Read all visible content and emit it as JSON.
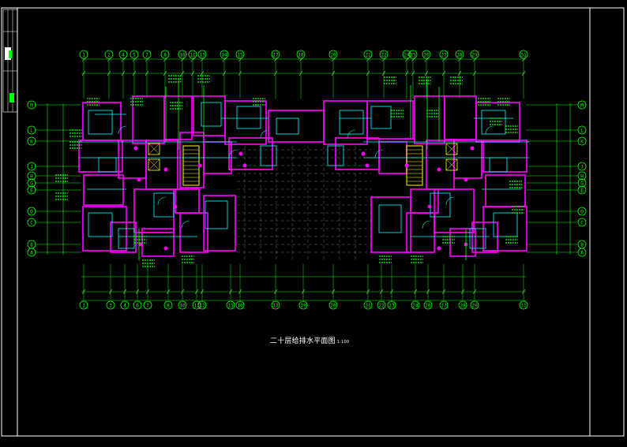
{
  "drawing": {
    "title": "二十层给排水平面图",
    "scale": "1:100",
    "colors": {
      "background": "#000000",
      "frame": "#ffffff",
      "axis": "#00ff00",
      "wall": "#ff00ff",
      "detail": "#00ffff",
      "fixture": "#ffff00",
      "dim": "#ffffff"
    },
    "top_axis_labels": [
      "1",
      "2",
      "4",
      "5",
      "7",
      "8",
      "10",
      "11",
      "13",
      "14",
      "15",
      "17",
      "18",
      "20",
      "21",
      "22",
      "24",
      "25",
      "26",
      "27",
      "28",
      "29",
      "31"
    ],
    "bottom_axis_labels": [
      "1",
      "3",
      "4",
      "6",
      "7",
      "8",
      "10",
      "11",
      "12",
      "15",
      "16",
      "17",
      "19",
      "20",
      "21",
      "22",
      "23",
      "24",
      "26",
      "27",
      "28",
      "29",
      "31"
    ],
    "side_axis_labels": [
      "M",
      "L",
      "K",
      "J",
      "H",
      "G",
      "E",
      "D",
      "C",
      "B",
      "A"
    ]
  }
}
